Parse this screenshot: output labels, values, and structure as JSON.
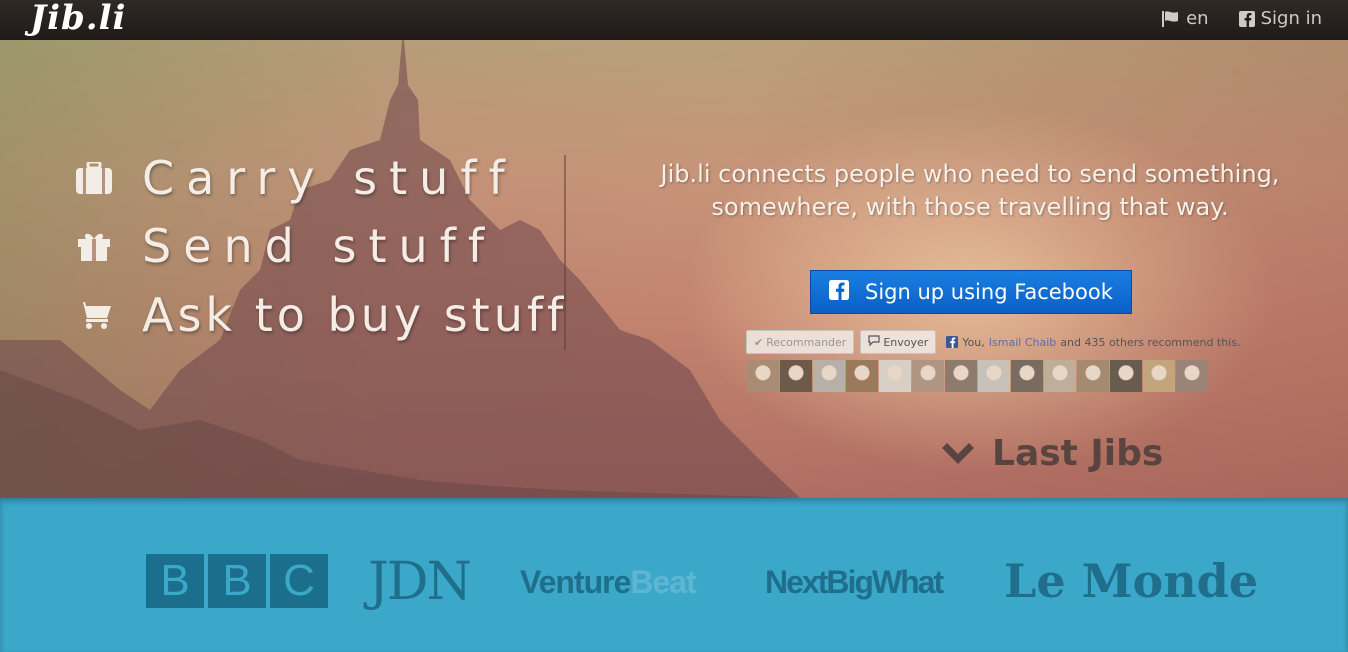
{
  "header": {
    "logo": "Jib.li",
    "language": "en",
    "signin": "Sign in"
  },
  "hero": {
    "taglines": [
      "Carry stuff",
      "Send stuff",
      "Ask to buy stuff"
    ],
    "pitch": "Jib.li connects people who need to send something, somewhere, with those travelling that way.",
    "facebook_button": "Sign up using Facebook",
    "like_bar": {
      "recommend": "Recommander",
      "send": "Envoyer",
      "text_you": "You,",
      "text_name": "Ismail Chaib",
      "text_rest": "and 435 others recommend this."
    },
    "faces": [
      {
        "color": "#a88d74"
      },
      {
        "color": "#6e5a4b"
      },
      {
        "color": "#b7b0a8"
      },
      {
        "color": "#9b7a5c"
      },
      {
        "color": "#d8cfc6"
      },
      {
        "color": "#b09582"
      },
      {
        "color": "#8f7b6d"
      },
      {
        "color": "#c8c1ba"
      },
      {
        "color": "#7a6b60"
      },
      {
        "color": "#bfae9a"
      },
      {
        "color": "#a48a6f"
      },
      {
        "color": "#6a5b51"
      },
      {
        "color": "#c2a57d"
      },
      {
        "color": "#9a8377"
      }
    ],
    "last_jibs": "Last Jibs"
  },
  "press": {
    "bbc": [
      "B",
      "B",
      "C"
    ],
    "jdn": "JDN",
    "venture": "Venture",
    "beat": "Beat",
    "nextbigwhat": "NextBigWhat",
    "lemonde": "Le Monde"
  }
}
